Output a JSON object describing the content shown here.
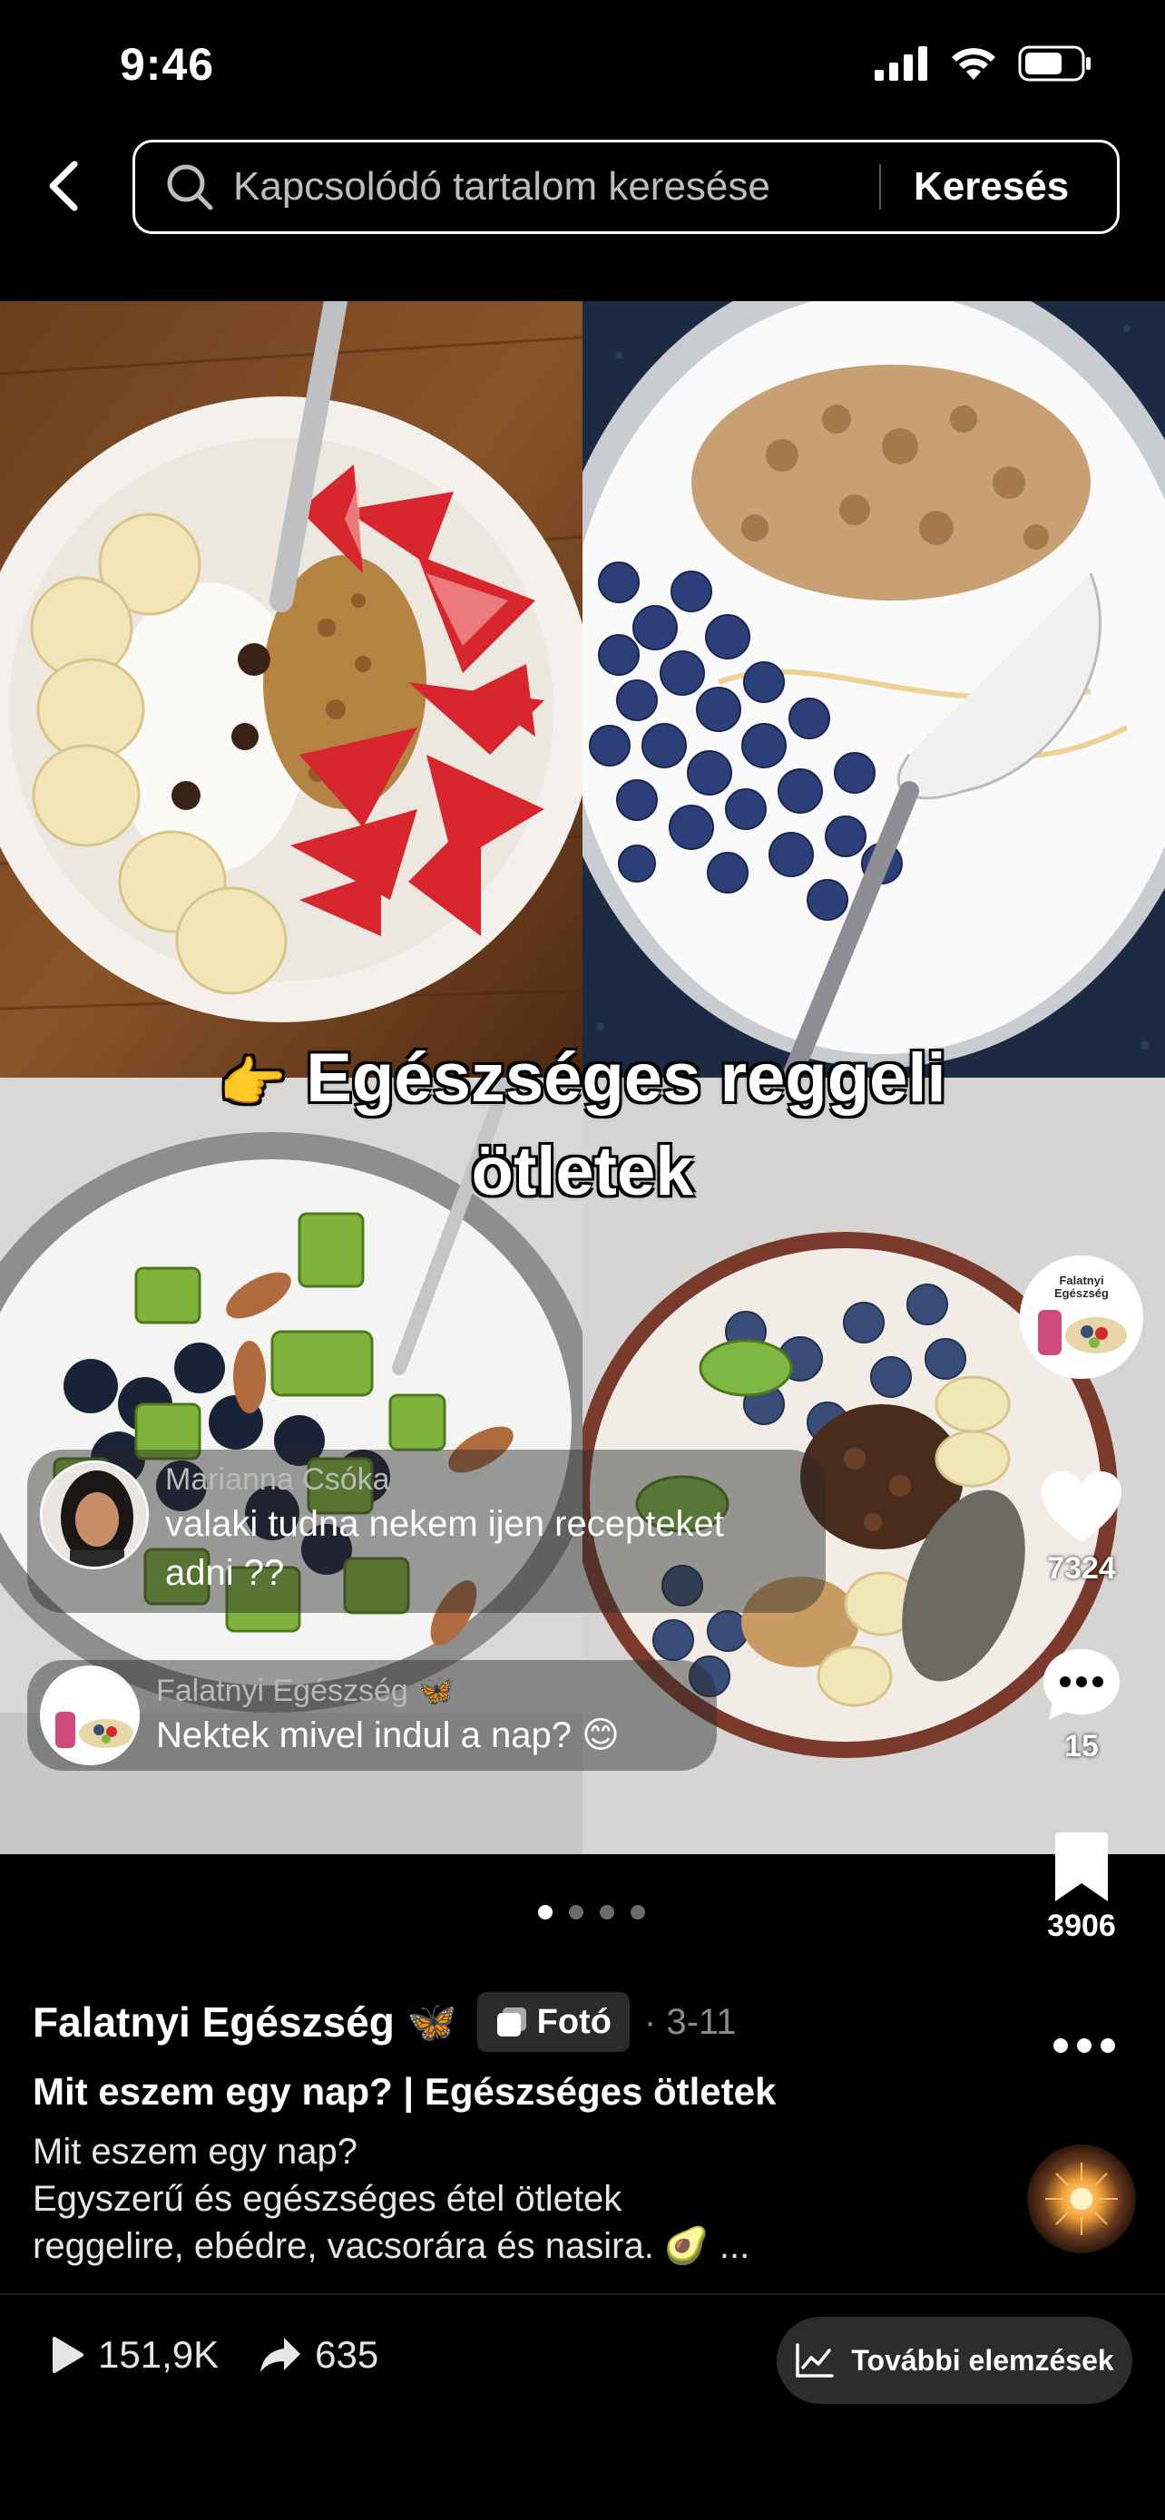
{
  "status_bar": {
    "time": "9:46"
  },
  "search": {
    "placeholder": "Kapcsolódó tartalom keresése",
    "submit_label": "Keresés"
  },
  "overlay": {
    "pointer_emoji": "👉",
    "title_line1": "Egészséges reggeli",
    "title_line2": "ötletek"
  },
  "comments": [
    {
      "author": "Marianna Csóka",
      "text_line1": "valaki tudna nekem ijen recepteket",
      "text_line2": "adni ??"
    },
    {
      "author": "Falatnyi Egészség 🦋",
      "text_line1": "Nektek mivel indul a nap? 😊"
    }
  ],
  "creator_badge": {
    "line1": "Falatnyi",
    "line2": "Egészség"
  },
  "actions": {
    "likes": "7324",
    "comments": "15",
    "saves": "3906"
  },
  "pagination": {
    "total": 4,
    "active": 1
  },
  "post": {
    "author": "Falatnyi Egészség",
    "author_emoji": "🦋",
    "type_badge": "Fotó",
    "date": "· 3-11",
    "title": "Mit eszem egy nap? | Egészséges ötletek",
    "desc_line1": "Mit eszem egy nap?",
    "desc_line2": "Egyszerű és egészséges étel ötletek",
    "desc_line3": "reggelire, ebédre, vacsorára és nasira. 🥑 ..."
  },
  "stats": {
    "views": "151,9K",
    "shares": "635",
    "analytics_label": "További elemzések"
  },
  "colors": {
    "background": "#000000",
    "badge_bg": "#2b2b2b",
    "muted_text": "#8a8a8a"
  }
}
